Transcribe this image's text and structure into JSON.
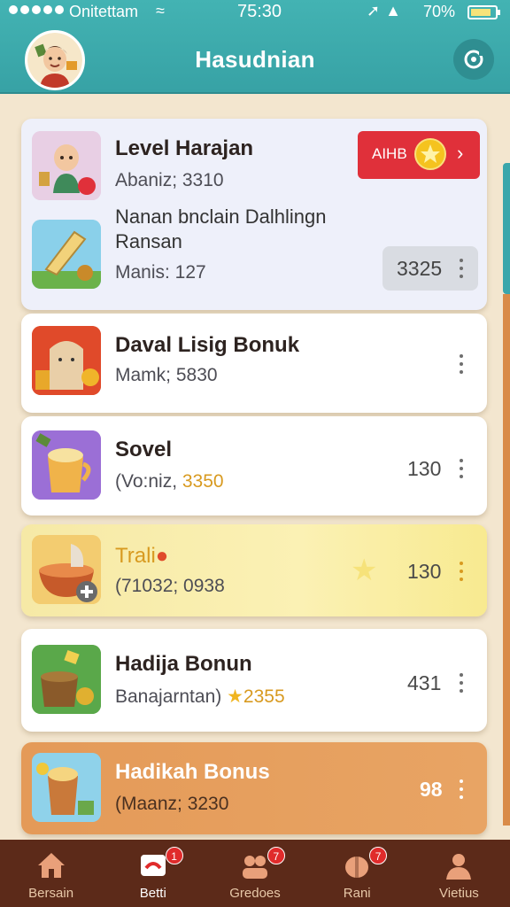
{
  "status_bar": {
    "carrier": "Onitettam",
    "time": "75:30",
    "battery": "70%"
  },
  "header": {
    "title": "Hasudnian"
  },
  "cards": [
    {
      "title": "Level Harajan",
      "subtitle": "Abaniz; 3310",
      "action_label": "AIHB"
    },
    {
      "title_line1": "Nanan bnclain Dalhlingn",
      "title_line2": "Ransan",
      "subtitle": "Manis: 127",
      "value": "3325"
    },
    {
      "title": "Daval Lisig Bonuk",
      "subtitle": "Mamk; 5830"
    },
    {
      "title": "Sovel",
      "subtitle_prefix": "(Vo:niz, ",
      "subtitle_value": "3350",
      "value": "130"
    },
    {
      "title": "Trali",
      "subtitle": "(71032; 0938",
      "value": "130"
    },
    {
      "title": "Hadija Bonun",
      "subtitle_prefix": "Banajarntan)",
      "subtitle_value": "2355",
      "value": "431"
    },
    {
      "title": "Hadikah Bonus",
      "subtitle": "(Maanz; 3230",
      "value": "98"
    }
  ],
  "tabs": [
    {
      "label": "Bersain",
      "icon": "home-icon"
    },
    {
      "label": "Betti",
      "icon": "game-icon",
      "badge": "1"
    },
    {
      "label": "Gredoes",
      "icon": "friends-icon",
      "badge": "7"
    },
    {
      "label": "Rani",
      "icon": "gift-icon",
      "badge": "7"
    },
    {
      "label": "Vietius",
      "icon": "profile-icon"
    }
  ],
  "colors": {
    "header": "#3aa9ab",
    "background": "#f3e6cf",
    "tabbar": "#5c2a19",
    "action_button": "#e0303a",
    "highlight_card": "#fbeeaa",
    "orange_card": "#e39a57"
  }
}
